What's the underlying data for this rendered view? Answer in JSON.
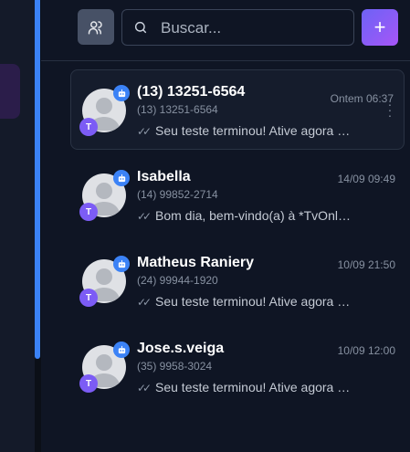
{
  "search": {
    "placeholder": "Buscar..."
  },
  "toolbar": {
    "add_label": "+"
  },
  "conversations": [
    {
      "name": "(13) 13251-6564",
      "phone": "(13) 13251-6564",
      "time": "Ontem 06:37",
      "preview": "Seu teste terminou! Ative agora seu plano",
      "badge": "T",
      "selected": true
    },
    {
      "name": "Isabella",
      "phone": "(14) 99852-2714",
      "time": "14/09 09:49",
      "preview": "Bom dia, bem-vindo(a) à *TvOnline*",
      "badge": "T",
      "selected": false
    },
    {
      "name": "Matheus Raniery",
      "phone": "(24) 99944-1920",
      "time": "10/09 21:50",
      "preview": "Seu teste terminou! Ative agora seu plano",
      "badge": "T",
      "selected": false
    },
    {
      "name": "Jose.s.veiga",
      "phone": "(35) 9958-3024",
      "time": "10/09 12:00",
      "preview": "Seu teste terminou! Ative agora seu plano",
      "badge": "T",
      "selected": false
    }
  ],
  "colors": {
    "accent": "#3b82f6",
    "badge": "#7c5cf5",
    "background": "#0f1524"
  }
}
